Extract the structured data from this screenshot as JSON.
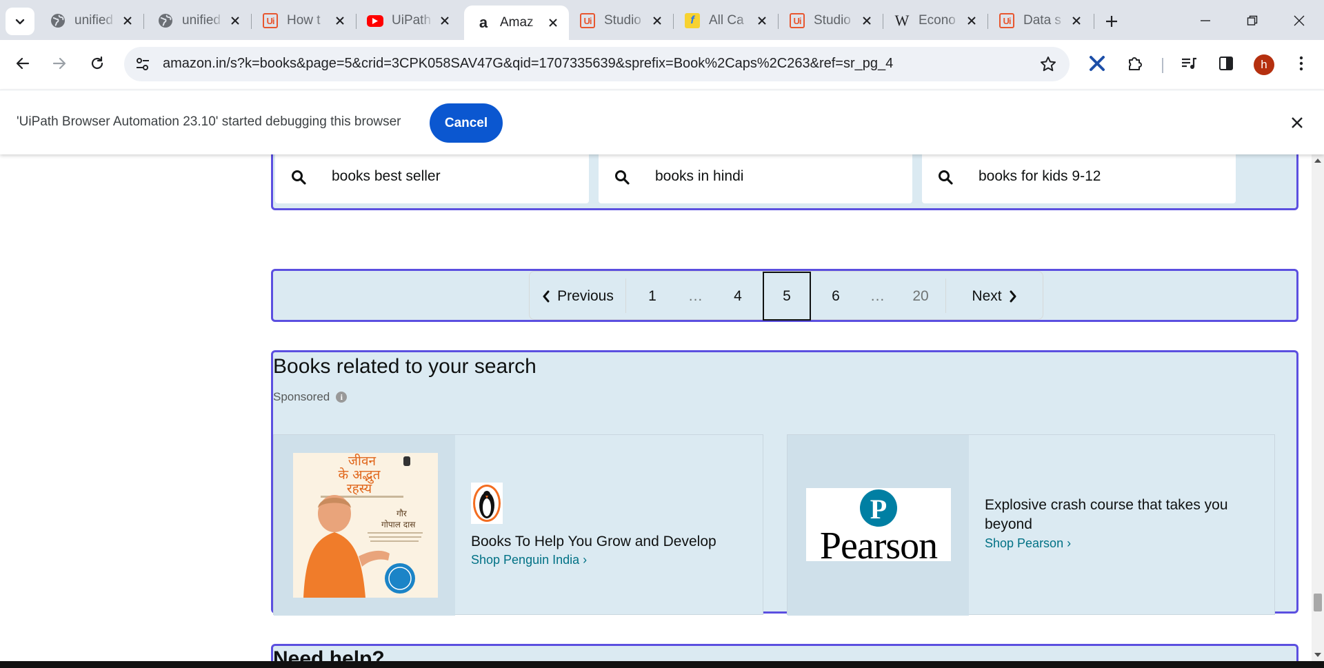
{
  "browser": {
    "tabs": [
      {
        "title": "unified",
        "icon": "globe-icon"
      },
      {
        "title": "unified",
        "icon": "globe-icon"
      },
      {
        "title": "How t",
        "icon": "uipath-icon"
      },
      {
        "title": "UiPath",
        "icon": "youtube-icon"
      },
      {
        "title": "Amaz",
        "icon": "amazon-icon",
        "active": true
      },
      {
        "title": "Studio",
        "icon": "uipath-icon"
      },
      {
        "title": "All Ca",
        "icon": "flipkart-icon"
      },
      {
        "title": "Studio",
        "icon": "uipath-icon"
      },
      {
        "title": "Econo",
        "icon": "wikipedia-icon"
      },
      {
        "title": "Data s",
        "icon": "uipath-icon"
      }
    ],
    "url": "amazon.in/s?k=books&page=5&crid=3CPK058SAV47G&qid=1707335639&sprefix=Book%2Caps%2C263&ref=sr_pg_4",
    "profile_initial": "h",
    "profile_color": "#b5300f"
  },
  "infobar": {
    "message": "'UiPath Browser Automation 23.10' started debugging this browser",
    "cancel_label": "Cancel",
    "button_color": "#0b57d0"
  },
  "related_searches": [
    "books best seller",
    "books in hindi",
    "books for kids 9-12"
  ],
  "pagination": {
    "previous_label": "Previous",
    "next_label": "Next",
    "pages": [
      "1",
      "...",
      "4",
      "5",
      "6",
      "...",
      "20"
    ],
    "current_page": "5"
  },
  "books_related": {
    "heading": "Books related to your search",
    "sponsored_label": "Sponsored",
    "ads": [
      {
        "book_cover_title": "जीवन के अद्भुत रहस्य",
        "book_author": "गौर गोपाल दास",
        "headline": "Books To Help You Grow and Develop",
        "shop_label": "Shop Penguin India ›"
      },
      {
        "brand_logo_text": "Pearson",
        "headline": "Explosive crash course that takes you beyond",
        "shop_label": "Shop Pearson ›"
      }
    ]
  },
  "help": {
    "heading": "Need help?"
  },
  "colors": {
    "card_background": "#dbeaf2",
    "card_border": "#5b4fe0",
    "link": "#007185"
  }
}
